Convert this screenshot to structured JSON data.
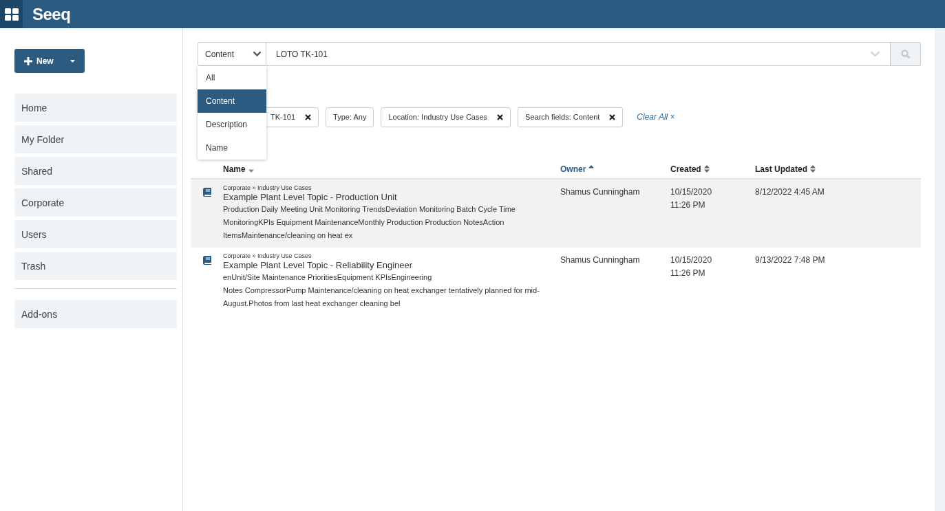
{
  "header": {
    "logo": "Seeq"
  },
  "sidebar": {
    "new_button": "New",
    "items": [
      {
        "label": "Home",
        "kind": "nav"
      },
      {
        "label": "My Folder",
        "kind": "nav"
      },
      {
        "label": "Shared",
        "kind": "nav"
      },
      {
        "label": "Corporate",
        "kind": "nav"
      },
      {
        "label": "Users",
        "kind": "nav"
      },
      {
        "label": "Trash",
        "kind": "nav"
      },
      {
        "label": "Add-ons",
        "kind": "addon"
      }
    ]
  },
  "search": {
    "scope": "Content",
    "value": "LOTO TK-101",
    "scope_options": [
      {
        "label": "All",
        "selected": false
      },
      {
        "label": "Content",
        "selected": true
      },
      {
        "label": "Description",
        "selected": false
      },
      {
        "label": "Name",
        "selected": false
      }
    ]
  },
  "filters": [
    {
      "label": "TK-101",
      "removable": true
    },
    {
      "label": "Type: Any",
      "removable": false
    },
    {
      "label": "Location: Industry Use Cases",
      "removable": true
    },
    {
      "label": "Search fields: Content",
      "removable": true
    }
  ],
  "clear_all": "Clear All ×",
  "table": {
    "columns": [
      {
        "label": "Name",
        "sort_up": false,
        "sort_down": true,
        "active": false
      },
      {
        "label": "Owner",
        "sort_up": true,
        "sort_down": false,
        "active": true
      },
      {
        "label": "Created",
        "sort_up": true,
        "sort_down": true,
        "active": false
      },
      {
        "label": "Last Updated",
        "sort_up": true,
        "sort_down": true,
        "active": false
      }
    ],
    "rows": [
      {
        "path": "Corporate » Industry Use Cases",
        "title": "Example Plant Level Topic - Production Unit",
        "description": "Production Daily Meeting Unit Monitoring TrendsDeviation Monitoring Batch Cycle Time MonitoringKPIs Equipment MaintenanceMonthly Production Production NotesAction ItemsMaintenance/cleaning on heat ex",
        "owner": "Shamus Cunningham",
        "created": "10/15/2020 11:26 PM",
        "updated": "8/12/2022 4:45 AM",
        "highlighted": true
      },
      {
        "path": "Corporate » Industry Use Cases",
        "title": "Example Plant Level Topic - Reliability Engineer",
        "description": "enUnit/Site Maintenance PrioritiesEquipment KPIsEngineering\nNotes CompressorPump Maintenance/cleaning on heat exchanger tentatively planned for mid-August.Photos from last heat exchanger cleaning bel",
        "owner": "Shamus Cunningham",
        "created": "10/15/2020 11:26 PM",
        "updated": "9/13/2022 7:48 PM",
        "highlighted": false
      }
    ]
  }
}
